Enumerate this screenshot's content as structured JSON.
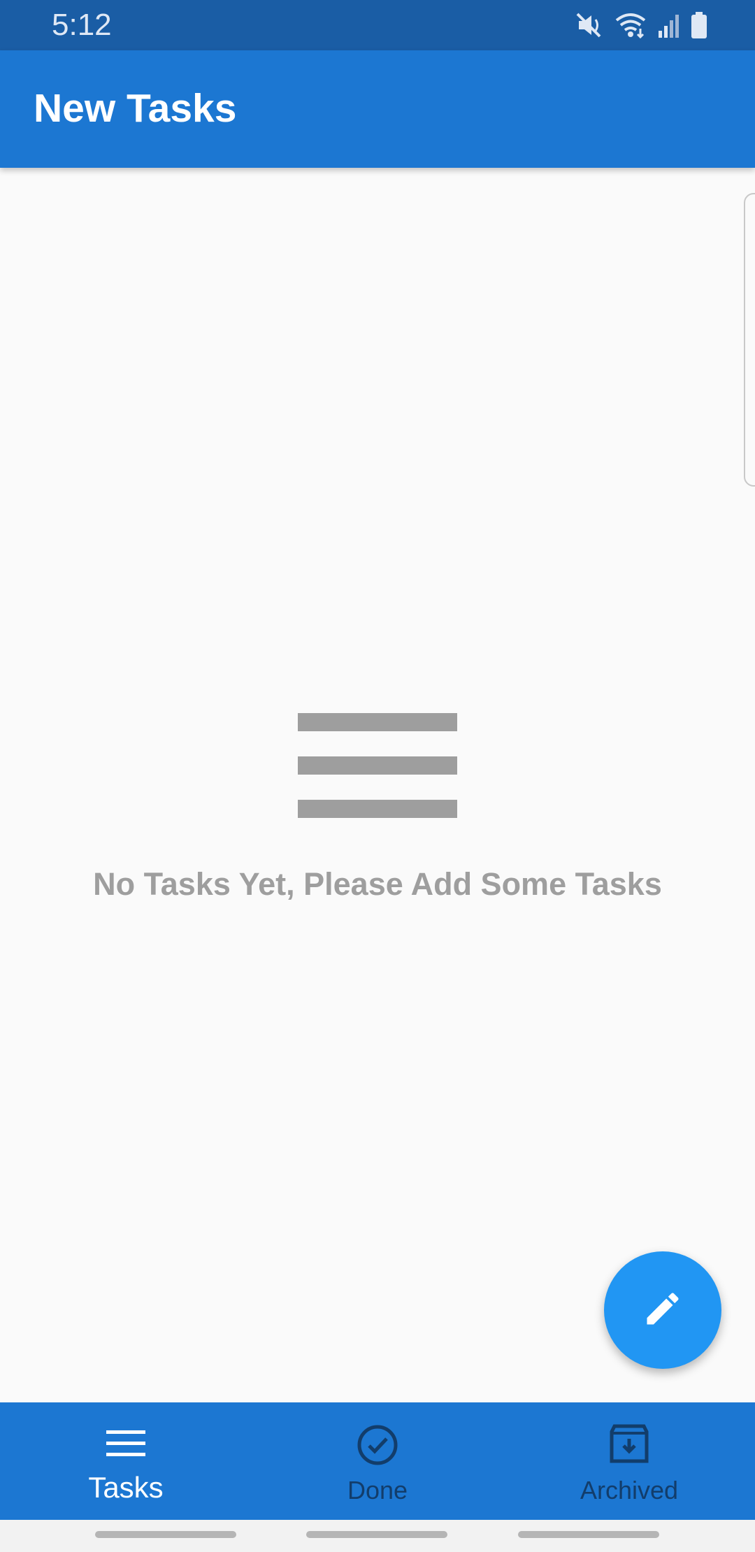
{
  "status_bar": {
    "time": "5:12",
    "icons": [
      "mute-icon",
      "wifi-icon",
      "signal-icon",
      "battery-icon"
    ]
  },
  "app_bar": {
    "title": "New Tasks"
  },
  "empty_state": {
    "icon": "menu-lines-icon",
    "message": "No Tasks Yet, Please Add Some Tasks"
  },
  "fab": {
    "icon": "pencil-icon"
  },
  "bottom_nav": {
    "items": [
      {
        "label": "Tasks",
        "icon": "menu-icon",
        "active": true
      },
      {
        "label": "Done",
        "icon": "check-circle-icon",
        "active": false
      },
      {
        "label": "Archived",
        "icon": "archive-icon",
        "active": false
      }
    ]
  },
  "colors": {
    "status_bar": "#1a5da5",
    "app_bar": "#1c77d2",
    "fab": "#2196f3",
    "background": "#fafafa",
    "empty_state_gray": "#9e9e9e",
    "nav_inactive": "#123d6b"
  }
}
